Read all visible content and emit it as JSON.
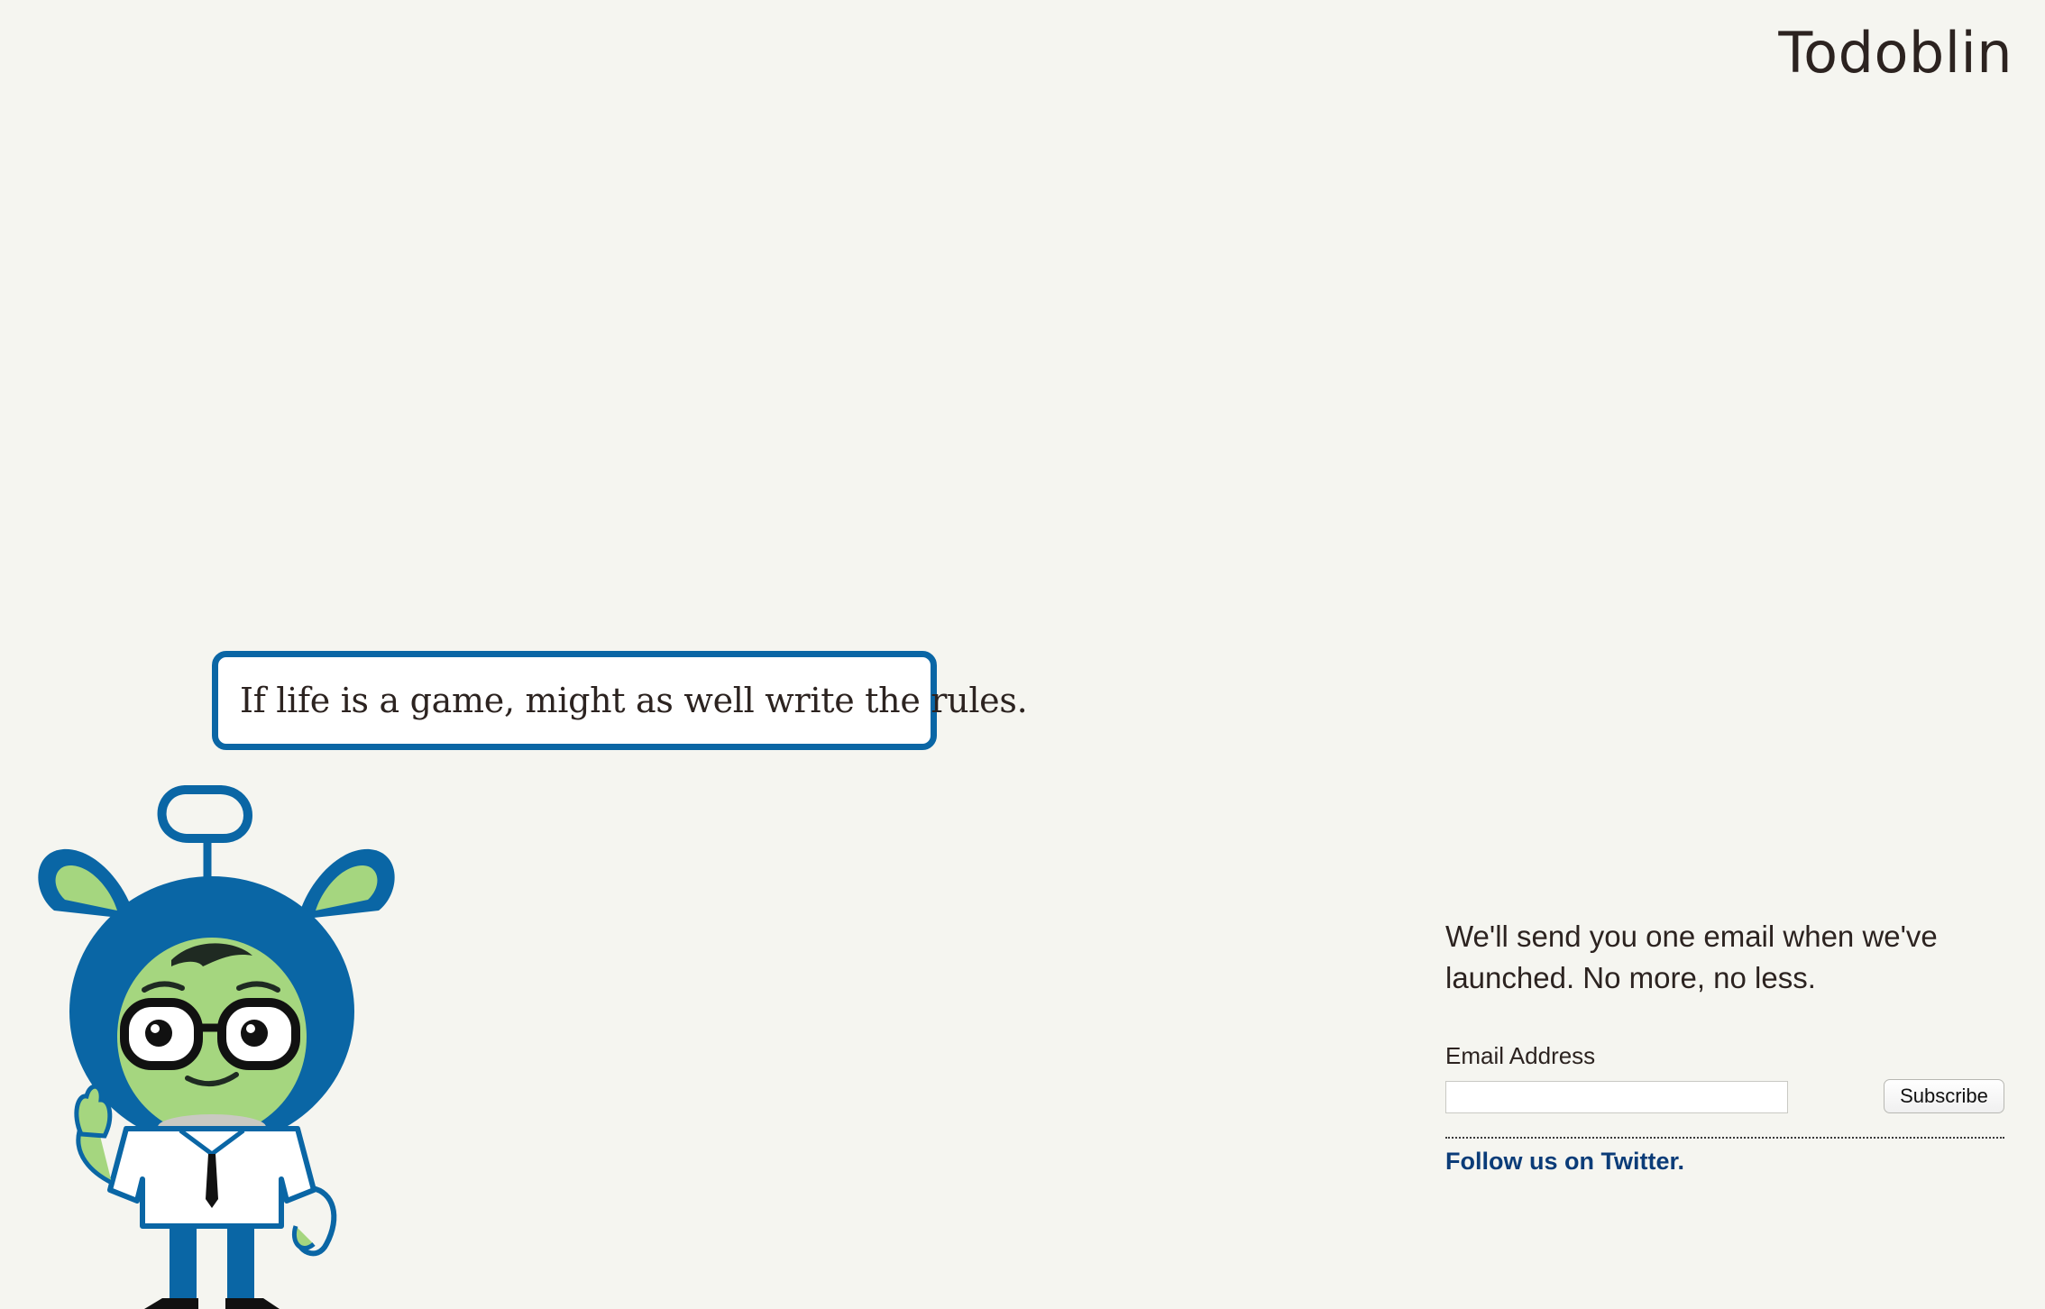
{
  "header": {
    "logo_text": "Todoblin"
  },
  "speech_bubble": {
    "text": "If life is a game, might as well write the rules."
  },
  "signup": {
    "tagline": "We'll send you one email when we've launched. No more, no less.",
    "email_label": "Email Address",
    "email_value": "",
    "subscribe_label": "Subscribe",
    "twitter_link": "Follow us on Twitter."
  },
  "colors": {
    "background": "#f5f5f0",
    "brand_blue": "#0a66a5",
    "link_blue": "#0b3c78",
    "mascot_green": "#a5d67f",
    "text_dark": "#2c2320"
  },
  "icons": {
    "mascot": "goblin-mascot-illustration"
  }
}
